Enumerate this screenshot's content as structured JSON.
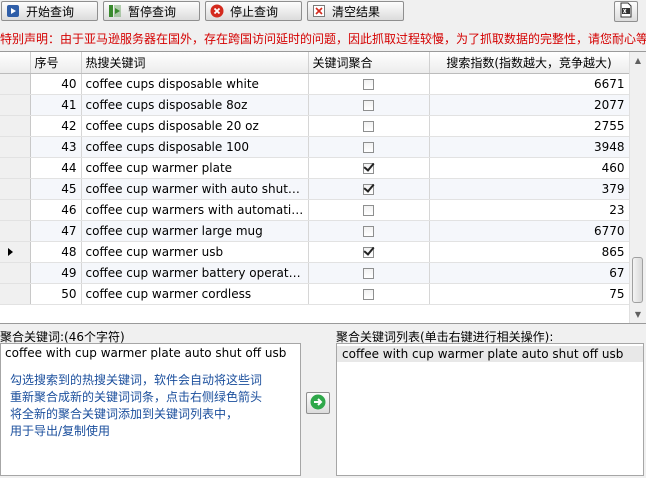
{
  "toolbar": {
    "start_label": "开始查询",
    "pause_label": "暂停查询",
    "stop_label": "停止查询",
    "clear_label": "清空结果",
    "icons": {
      "start": "play-icon",
      "pause": "pause-icon",
      "stop": "stop-icon",
      "clear": "clear-icon",
      "export": "excel-export-icon"
    },
    "colors": {
      "play": "#2f5ea8",
      "pause": "#3a8a2e",
      "stop": "#d42a1e"
    }
  },
  "notice": "特别声明：由于亚马逊服务器在国外，存在跨国访问延时的问题，因此抓取过程较慢，为了抓取数据的完整性，请您耐心等",
  "table": {
    "columns": [
      "序号",
      "热搜关键词",
      "关键词聚合",
      "搜索指数(指数越大，竞争越大)"
    ],
    "rows": [
      {
        "seq": "40",
        "keyword": "coffee cups disposable white",
        "checked": false,
        "index": "6671"
      },
      {
        "seq": "41",
        "keyword": "coffee cups disposable 8oz",
        "checked": false,
        "index": "2077"
      },
      {
        "seq": "42",
        "keyword": "coffee cups disposable 20 oz",
        "checked": false,
        "index": "2755"
      },
      {
        "seq": "43",
        "keyword": "coffee cups disposable 100",
        "checked": false,
        "index": "3948"
      },
      {
        "seq": "44",
        "keyword": "coffee cup warmer plate",
        "checked": true,
        "index": "460"
      },
      {
        "seq": "45",
        "keyword": "coffee cup warmer with auto shut off",
        "checked": true,
        "index": "379"
      },
      {
        "seq": "46",
        "keyword": "coffee cup warmers with automatic s...",
        "checked": false,
        "index": "23"
      },
      {
        "seq": "47",
        "keyword": "coffee cup warmer large mug",
        "checked": false,
        "index": "6770"
      },
      {
        "seq": "48",
        "keyword": "coffee cup warmer usb",
        "checked": true,
        "index": "865",
        "current": true
      },
      {
        "seq": "49",
        "keyword": "coffee cup warmer battery operated",
        "checked": false,
        "index": "67"
      },
      {
        "seq": "50",
        "keyword": "coffee cup warmer cordless",
        "checked": false,
        "index": "75"
      }
    ]
  },
  "aggregate": {
    "label": "聚合关键词:(46个字符)",
    "text": "coffee with cup warmer plate auto shut off usb",
    "hint": "勾选搜索到的热搜关键词，软件会自动将这些词\n重新聚合成新的关键词词条，点击右侧绿色箭头\n将全新的聚合关键词添加到关键词列表中，\n用于导出/复制使用",
    "hint_color": "#1a4e9c",
    "arrow_icon": "green-arrow-right-icon"
  },
  "keyword_list": {
    "label": "聚合关键词列表(单击右键进行相关操作):",
    "items": [
      "coffee with cup warmer plate auto shut off usb"
    ]
  }
}
